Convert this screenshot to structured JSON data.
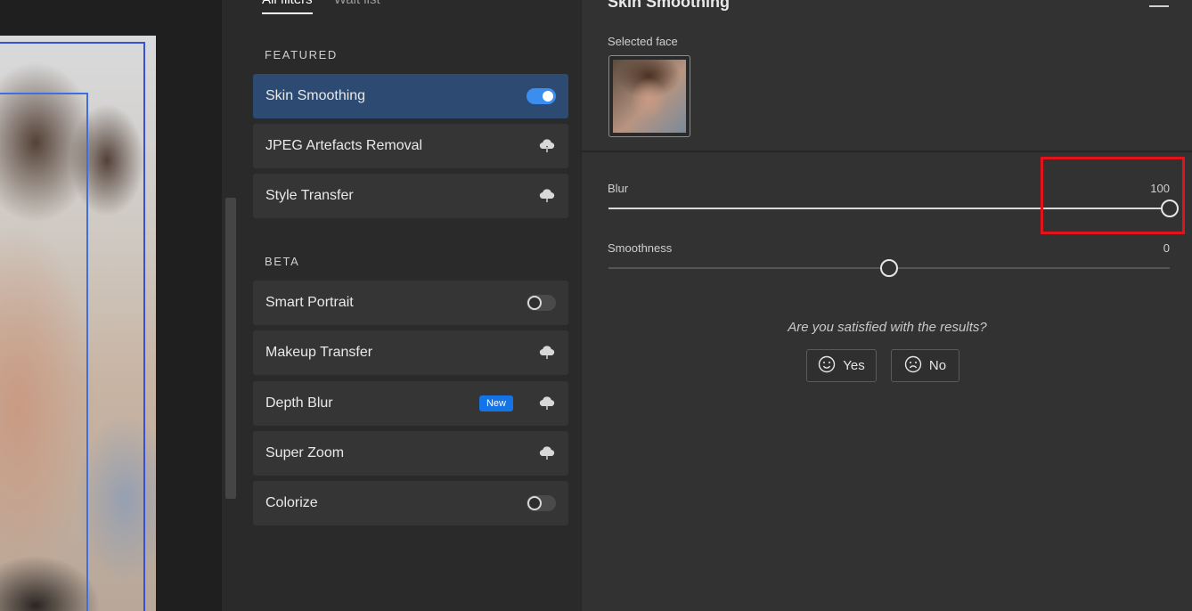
{
  "tabs": [
    {
      "label": "All filters",
      "active": true
    },
    {
      "label": "Wait list",
      "active": false
    }
  ],
  "sections": {
    "featured": "FEATURED",
    "beta": "BETA"
  },
  "featured_items": [
    {
      "label": "Skin Smoothing",
      "control": "toggle-on",
      "selected": true
    },
    {
      "label": "JPEG Artefacts Removal",
      "control": "cloud-download-icon"
    },
    {
      "label": "Style Transfer",
      "control": "cloud-download-icon"
    }
  ],
  "beta_items": [
    {
      "label": "Smart Portrait",
      "control": "toggle-off"
    },
    {
      "label": "Makeup Transfer",
      "control": "cloud-download-icon"
    },
    {
      "label": "Depth Blur",
      "control": "cloud-download-icon",
      "badge": "New"
    },
    {
      "label": "Super Zoom",
      "control": "cloud-download-icon"
    },
    {
      "label": "Colorize",
      "control": "toggle-off"
    }
  ],
  "panel": {
    "title": "Skin Smoothing",
    "selected_face_label": "Selected face",
    "sliders": [
      {
        "label": "Blur",
        "value": "100",
        "min": 0,
        "max": 100,
        "current": 100
      },
      {
        "label": "Smoothness",
        "value": "0",
        "min": -50,
        "max": 50,
        "current": 0
      }
    ],
    "question": "Are you satisfied with the results?",
    "yes_label": "Yes",
    "no_label": "No"
  },
  "colors": {
    "accent": "#1473e6",
    "selected_row": "#2c4a72",
    "highlight": "#e0141a"
  }
}
